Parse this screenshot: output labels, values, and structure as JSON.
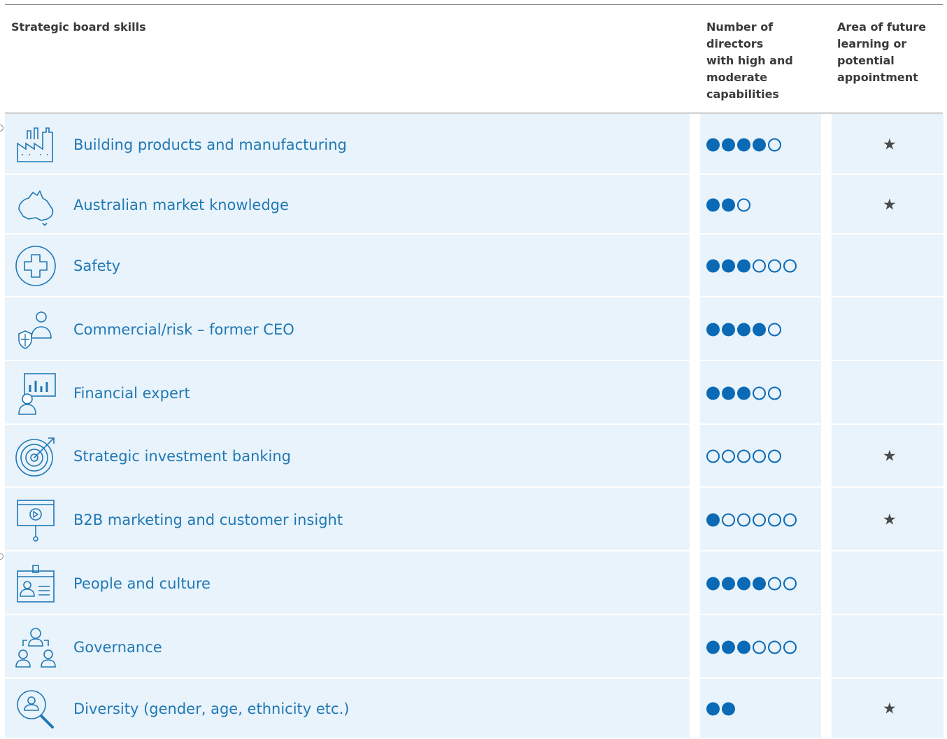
{
  "header": {
    "skills": "Strategic board skills",
    "count": "Number of\ndirectors\nwith high and\nmoderate\ncapabilities",
    "future": "Area of future\nlearning or\npotential\nappointment"
  },
  "colors": {
    "accent": "#1f78b4",
    "dot": "#0a6ab6",
    "band": "#e9f3fb",
    "star": "#4a4a4a"
  },
  "star_symbol": "★",
  "rows": [
    {
      "label": "Building products and manufacturing",
      "icon": "factory-icon",
      "high": 4,
      "moderate": 1,
      "future": true
    },
    {
      "label": "Australian market knowledge",
      "icon": "australia-map-icon",
      "high": 2,
      "moderate": 1,
      "future": true
    },
    {
      "label": "Safety",
      "icon": "medical-cross-icon",
      "high": 3,
      "moderate": 3,
      "future": false
    },
    {
      "label": "Commercial/risk – former CEO",
      "icon": "shield-person-icon",
      "high": 4,
      "moderate": 1,
      "future": false
    },
    {
      "label": "Financial expert",
      "icon": "presenter-chart-icon",
      "high": 3,
      "moderate": 2,
      "future": false
    },
    {
      "label": "Strategic investment banking",
      "icon": "target-icon",
      "high": 0,
      "moderate": 5,
      "future": true
    },
    {
      "label": "B2B marketing and customer insight",
      "icon": "presentation-screen-icon",
      "high": 1,
      "moderate": 5,
      "future": true
    },
    {
      "label": "People and culture",
      "icon": "id-badge-icon",
      "high": 4,
      "moderate": 2,
      "future": false
    },
    {
      "label": "Governance",
      "icon": "people-hierarchy-icon",
      "high": 3,
      "moderate": 3,
      "future": false
    },
    {
      "label": "Diversity (gender, age, ethnicity etc.)",
      "icon": "person-search-icon",
      "high": 2,
      "moderate": 0,
      "future": true
    }
  ]
}
